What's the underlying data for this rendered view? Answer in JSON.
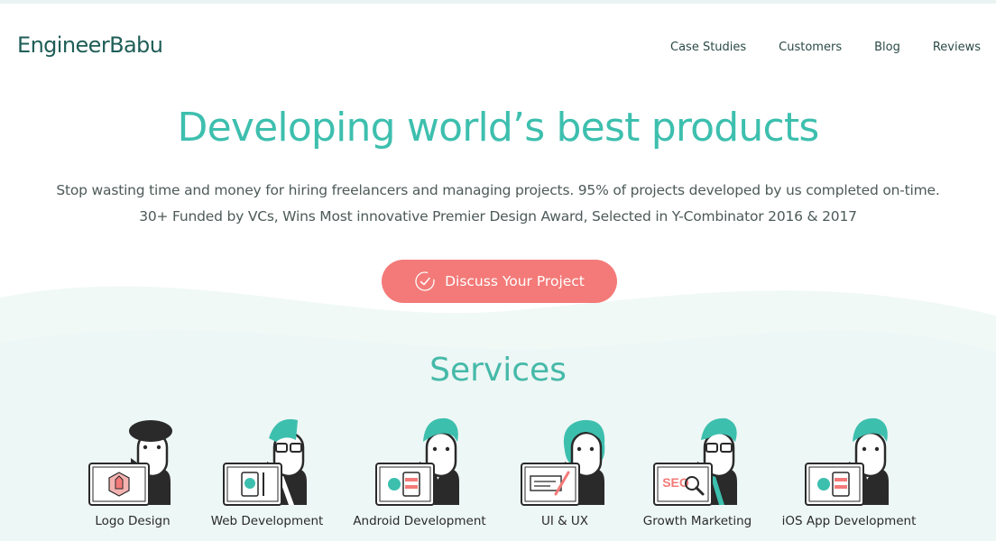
{
  "brand": {
    "name": "EngineerBabu"
  },
  "nav": {
    "items": [
      "Case Studies",
      "Customers",
      "Blog",
      "Reviews"
    ]
  },
  "hero": {
    "title": "Developing world’s best products",
    "subtitle_line1": "Stop wasting time and money for hiring freelancers and managing projects. 95% of projects developed by us completed on-time.",
    "subtitle_line2": "30+ Funded by VCs, Wins Most innovative Premier Design Award, Selected in Y-Combinator 2016 & 2017",
    "cta_label": "Discuss Your Project"
  },
  "services": {
    "title": "Services",
    "items": [
      {
        "label": "Logo Design",
        "icon": "logo-design-icon"
      },
      {
        "label": "Web Development",
        "icon": "web-development-icon"
      },
      {
        "label": "Android Development",
        "icon": "android-development-icon"
      },
      {
        "label": "UI & UX",
        "icon": "ui-ux-icon"
      },
      {
        "label": "Growth Marketing",
        "icon": "growth-marketing-icon",
        "screen_text": "SEO"
      },
      {
        "label": "iOS App Development",
        "icon": "ios-app-development-icon"
      }
    ]
  },
  "colors": {
    "accent": "#3dbfae",
    "cta": "#f37a78",
    "brand_text": "#1f5e57"
  }
}
